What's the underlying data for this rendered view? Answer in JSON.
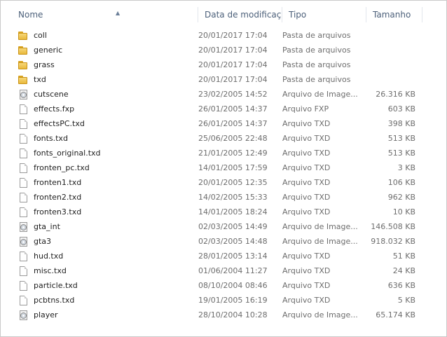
{
  "header": {
    "name": "Nome",
    "date": "Data de modificaç...",
    "type": "Tipo",
    "size": "Tamanho"
  },
  "sort_indicator": "▲",
  "files": [
    {
      "name": "coll",
      "date": "20/01/2017 17:04",
      "type": "Pasta de arquivos",
      "size": "",
      "icon": "folder-icon"
    },
    {
      "name": "generic",
      "date": "20/01/2017 17:04",
      "type": "Pasta de arquivos",
      "size": "",
      "icon": "folder-icon"
    },
    {
      "name": "grass",
      "date": "20/01/2017 17:04",
      "type": "Pasta de arquivos",
      "size": "",
      "icon": "folder-icon"
    },
    {
      "name": "txd",
      "date": "20/01/2017 17:04",
      "type": "Pasta de arquivos",
      "size": "",
      "icon": "folder-icon"
    },
    {
      "name": "cutscene",
      "date": "23/02/2005 14:52",
      "type": "Arquivo de Image...",
      "size": "26.316 KB",
      "icon": "disc-image-icon"
    },
    {
      "name": "effects.fxp",
      "date": "26/01/2005 14:37",
      "type": "Arquivo FXP",
      "size": "603 KB",
      "icon": "file-icon"
    },
    {
      "name": "effectsPC.txd",
      "date": "26/01/2005 14:37",
      "type": "Arquivo TXD",
      "size": "398 KB",
      "icon": "file-icon"
    },
    {
      "name": "fonts.txd",
      "date": "25/06/2005 22:48",
      "type": "Arquivo TXD",
      "size": "513 KB",
      "icon": "file-icon"
    },
    {
      "name": "fonts_original.txd",
      "date": "21/01/2005 12:49",
      "type": "Arquivo TXD",
      "size": "513 KB",
      "icon": "file-icon"
    },
    {
      "name": "fronten_pc.txd",
      "date": "14/01/2005 17:59",
      "type": "Arquivo TXD",
      "size": "3 KB",
      "icon": "file-icon"
    },
    {
      "name": "fronten1.txd",
      "date": "20/01/2005 12:35",
      "type": "Arquivo TXD",
      "size": "106 KB",
      "icon": "file-icon"
    },
    {
      "name": "fronten2.txd",
      "date": "14/02/2005 15:33",
      "type": "Arquivo TXD",
      "size": "962 KB",
      "icon": "file-icon"
    },
    {
      "name": "fronten3.txd",
      "date": "14/01/2005 18:24",
      "type": "Arquivo TXD",
      "size": "10 KB",
      "icon": "file-icon"
    },
    {
      "name": "gta_int",
      "date": "02/03/2005 14:49",
      "type": "Arquivo de Image...",
      "size": "146.508 KB",
      "icon": "disc-image-icon"
    },
    {
      "name": "gta3",
      "date": "02/03/2005 14:48",
      "type": "Arquivo de Image...",
      "size": "918.032 KB",
      "icon": "disc-image-icon"
    },
    {
      "name": "hud.txd",
      "date": "28/01/2005 13:14",
      "type": "Arquivo TXD",
      "size": "51 KB",
      "icon": "file-icon"
    },
    {
      "name": "misc.txd",
      "date": "01/06/2004 11:27",
      "type": "Arquivo TXD",
      "size": "24 KB",
      "icon": "file-icon"
    },
    {
      "name": "particle.txd",
      "date": "08/10/2004 08:46",
      "type": "Arquivo TXD",
      "size": "636 KB",
      "icon": "file-icon"
    },
    {
      "name": "pcbtns.txd",
      "date": "19/01/2005 16:19",
      "type": "Arquivo TXD",
      "size": "5 KB",
      "icon": "file-icon"
    },
    {
      "name": "player",
      "date": "28/10/2004 10:28",
      "type": "Arquivo de Image...",
      "size": "65.174 KB",
      "icon": "disc-image-icon"
    }
  ]
}
